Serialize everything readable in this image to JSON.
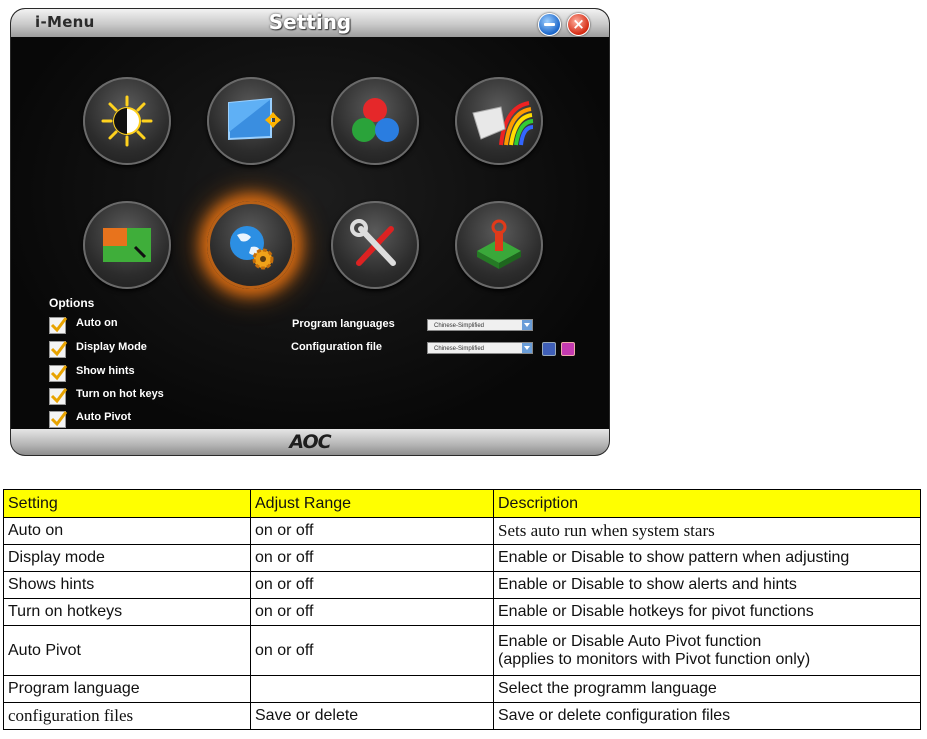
{
  "window": {
    "app_name": "i-Menu",
    "title": "Setting",
    "brand": "AOC"
  },
  "icons": [
    {
      "name": "brightness-icon",
      "active": false
    },
    {
      "name": "image-position-icon",
      "active": false
    },
    {
      "name": "color-setup-icon",
      "active": false
    },
    {
      "name": "picture-boost-icon",
      "active": false
    },
    {
      "name": "osd-setup-icon",
      "active": false
    },
    {
      "name": "settings-globe-icon",
      "active": true
    },
    {
      "name": "tools-icon",
      "active": false
    },
    {
      "name": "exit-icon",
      "active": false
    }
  ],
  "options": {
    "title": "Options",
    "items": [
      {
        "label": "Auto on",
        "checked": true
      },
      {
        "label": "Display Mode",
        "checked": true
      },
      {
        "label": "Show hints",
        "checked": true
      },
      {
        "label": "Turn on hot keys",
        "checked": true
      },
      {
        "label": "Auto Pivot",
        "checked": true
      }
    ]
  },
  "program_languages": {
    "label": "Program languages",
    "value": "Chinese-Simplified"
  },
  "configuration_file": {
    "label": "Configuration file",
    "value": "Chinese-Simplified"
  },
  "table": {
    "headers": [
      "Setting",
      "Adjust Range",
      "Description"
    ],
    "rows": [
      [
        "Auto on",
        "on or off",
        "Sets auto run when system stars"
      ],
      [
        "Display mode",
        "on or off",
        "Enable or Disable to show pattern when adjusting"
      ],
      [
        "Shows hints",
        "on or off",
        "Enable or Disable to show alerts and hints"
      ],
      [
        "Turn on hotkeys",
        "on or off",
        "Enable or Disable hotkeys for pivot functions"
      ],
      [
        "Auto Pivot",
        "on or off",
        "Enable or Disable Auto Pivot function",
        "(applies to monitors with Pivot function only)"
      ],
      [
        "Program  language",
        "",
        "Select the programm language"
      ],
      [
        "configuration files",
        "Save or delete",
        "Save or delete configuration files"
      ]
    ]
  },
  "colors": {
    "header_bg": "#ffff00",
    "active_glow": "#d66a12",
    "check": "#e8a300"
  }
}
